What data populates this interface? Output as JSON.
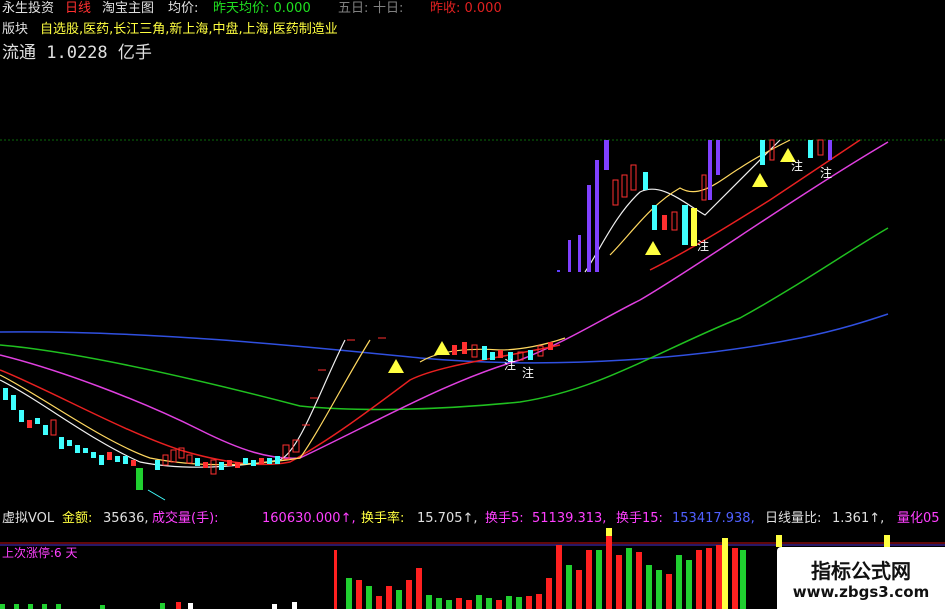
{
  "header": {
    "app_name": "永生投资",
    "period": "日线",
    "main_chart": "淘宝主图",
    "avg_label": "均价:",
    "prev_avg": "昨天均价: 0.000",
    "five_day": "五日:",
    "ten_day": "十日:",
    "prev_close": "昨收: 0.000"
  },
  "sector": {
    "label": "版块",
    "value": "自选股,医药,长江三角,新上海,中盘,上海,医药制造业"
  },
  "float_shares": "流通 1.0228 亿手",
  "annotation_glyph": "注",
  "volume_panel": {
    "name": "虚拟VOL",
    "amount_label": "金额:",
    "amount_value": "35636,",
    "volume_label": "成交量(手):",
    "volume_value": "160630.000↑,",
    "turnover_label": "换手率:",
    "turnover_value": "15.705↑,",
    "turnover5_label": "换手5:",
    "turnover5_value": "51139.313,",
    "turnover15_label": "换手15:",
    "turnover15_value": "153417.938,",
    "vol_ratio_label": "日线量比:",
    "vol_ratio_value": "1.361↑,",
    "quant_label": "量化05"
  },
  "limit_up_note": "上次涨停:6 天",
  "watermark": {
    "title": "指标公式网",
    "url": "www.zbgs3.com"
  },
  "colors": {
    "background": "#000000",
    "up": "#ff3030",
    "down": "#40ffff",
    "yellow": "#ffff40",
    "green_line": "#20c020",
    "blue_line": "#3050e0",
    "magenta": "#e040e0",
    "white_line": "#f0f0f0",
    "panel_border": "#c01010",
    "volume_red": "#ff2020",
    "volume_green": "#20d030",
    "volume_panel_title": "#ff40ff"
  }
}
